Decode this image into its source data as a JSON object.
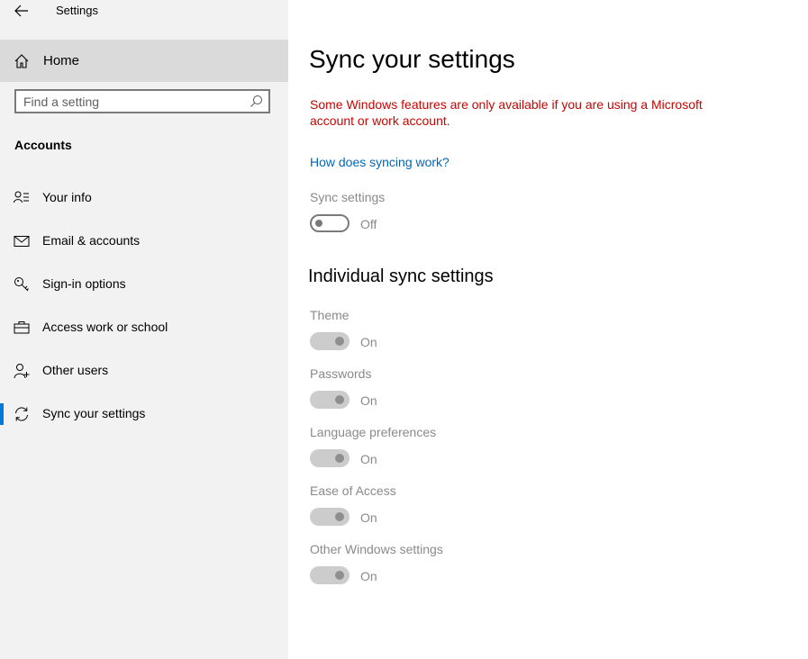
{
  "window": {
    "title": "Settings"
  },
  "sidebar": {
    "home_label": "Home",
    "search_placeholder": "Find a setting",
    "section_heading": "Accounts",
    "items": [
      {
        "label": "Your info",
        "icon": "person-list-icon"
      },
      {
        "label": "Email & accounts",
        "icon": "mail-icon"
      },
      {
        "label": "Sign-in options",
        "icon": "key-icon"
      },
      {
        "label": "Access work or school",
        "icon": "briefcase-icon"
      },
      {
        "label": "Other users",
        "icon": "person-add-icon"
      },
      {
        "label": "Sync your settings",
        "icon": "sync-icon",
        "selected": true
      }
    ]
  },
  "main": {
    "title": "Sync your settings",
    "warning": "Some Windows features are only available if you are using a Microsoft account or work account.",
    "help_link": "How does syncing work?",
    "sync": {
      "label": "Sync settings",
      "state": "Off"
    },
    "individual_heading": "Individual sync settings",
    "individual": [
      {
        "label": "Theme",
        "state": "On"
      },
      {
        "label": "Passwords",
        "state": "On"
      },
      {
        "label": "Language preferences",
        "state": "On"
      },
      {
        "label": "Ease of Access",
        "state": "On"
      },
      {
        "label": "Other Windows settings",
        "state": "On"
      }
    ]
  },
  "colors": {
    "accent": "#0078d7",
    "warning": "#c50500",
    "link": "#0067b8",
    "disabled_text": "#8a8a8a"
  }
}
